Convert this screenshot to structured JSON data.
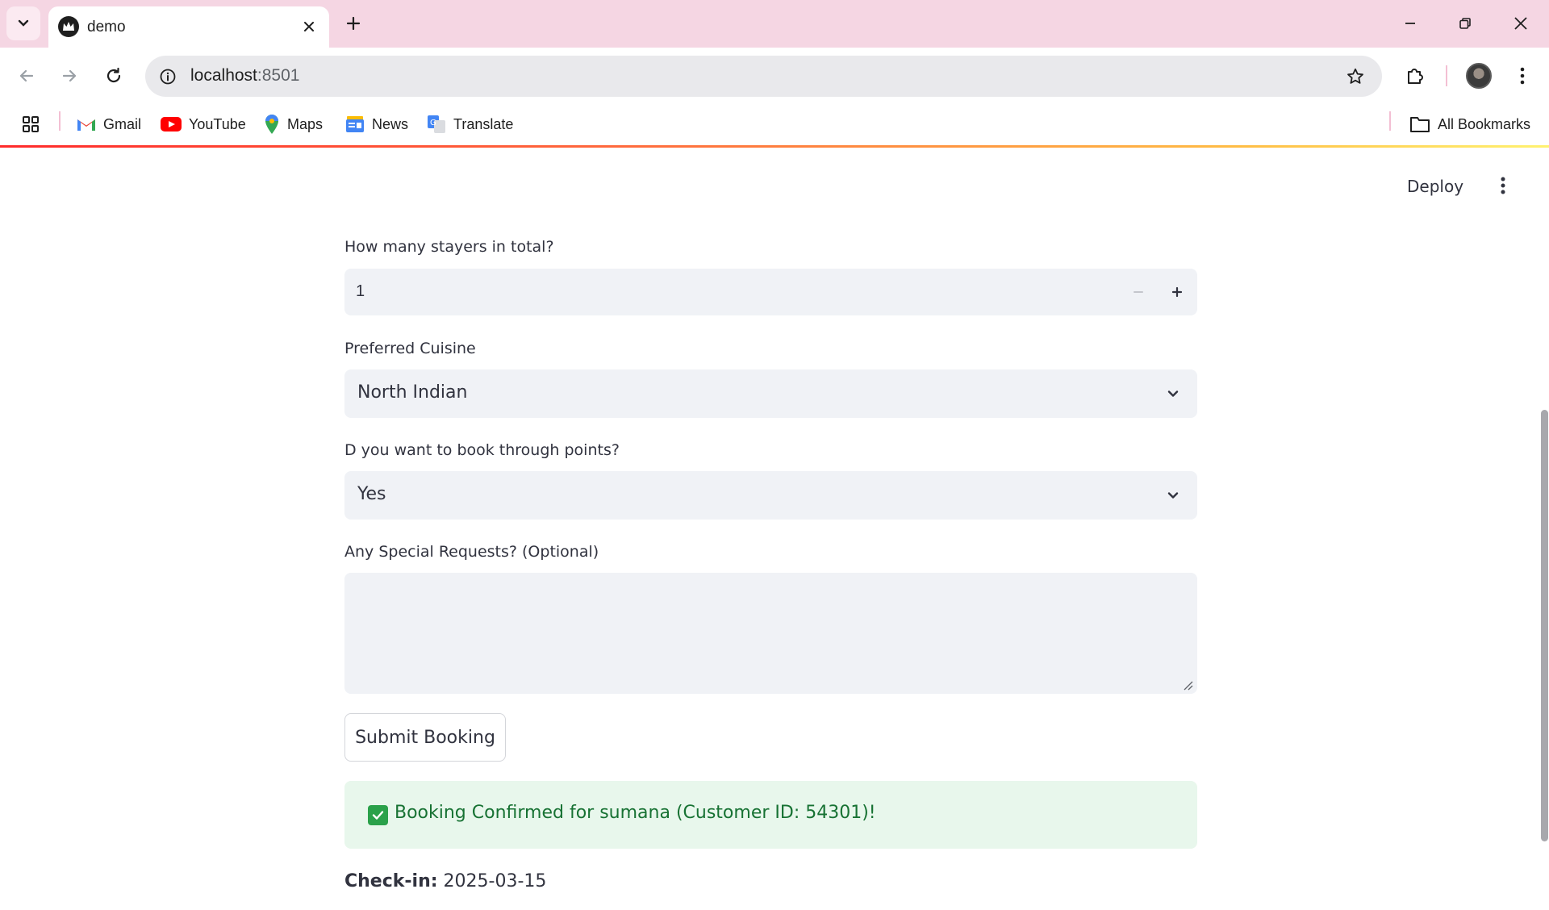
{
  "browser": {
    "tab_title": "demo",
    "url_host": "localhost",
    "url_port": ":8501",
    "bookmarks": [
      {
        "label": "Gmail",
        "icon": "gmail-icon"
      },
      {
        "label": "YouTube",
        "icon": "youtube-icon"
      },
      {
        "label": "Maps",
        "icon": "maps-icon"
      },
      {
        "label": "News",
        "icon": "news-icon"
      },
      {
        "label": "Translate",
        "icon": "translate-icon"
      }
    ],
    "all_bookmarks": "All Bookmarks"
  },
  "app": {
    "deploy_label": "Deploy",
    "stayers": {
      "label": "How many stayers in total?",
      "value": "1"
    },
    "cuisine": {
      "label": "Preferred Cuisine",
      "value": "North Indian"
    },
    "points": {
      "label": "D you want to book through points?",
      "value": "Yes"
    },
    "requests": {
      "label": "Any Special Requests? (Optional)",
      "value": ""
    },
    "submit_label": "Submit Booking",
    "success_message": "Booking Confirmed for sumana (Customer ID: 54301)!",
    "checkin": {
      "label": "Check-in:",
      "value": "2025-03-15"
    }
  },
  "colors": {
    "tabbar": "#f5d6e3",
    "field_bg": "#f0f2f6",
    "success_bg": "#e8f7ec",
    "success_text": "#177233"
  }
}
